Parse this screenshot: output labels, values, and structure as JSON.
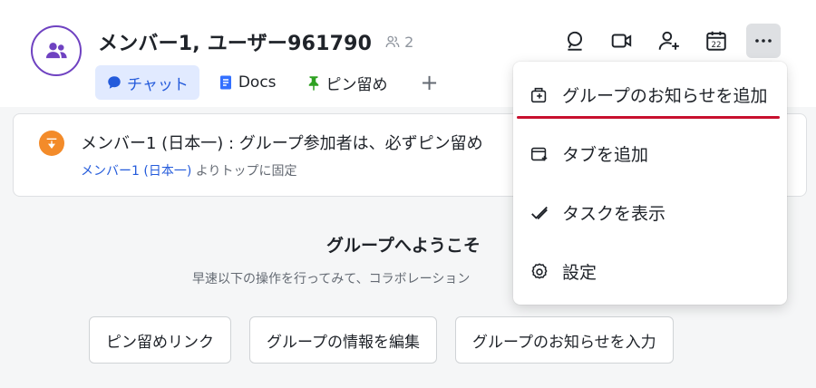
{
  "header": {
    "title": "メンバー1, ユーザー961790",
    "member_count": "2",
    "tabs": [
      {
        "label": "チャット"
      },
      {
        "label": "Docs"
      },
      {
        "label": "ピン留め"
      }
    ],
    "add_tab": "+"
  },
  "toolbar": {
    "icons": [
      "search-icon",
      "video-call-icon",
      "add-member-icon",
      "calendar-icon",
      "more-icon"
    ],
    "calendar_day": "22"
  },
  "pinned": {
    "message": "メンバー1 (日本一) : グループ参加者は、必ずピン留め",
    "by": "メンバー1 (日本一)",
    "suffix": " よりトップに固定"
  },
  "welcome": {
    "title": "グループへようこそ",
    "subtitle": "早速以下の操作を行ってみて、コラボレーション"
  },
  "actions": [
    {
      "label": "ピン留めリンク"
    },
    {
      "label": "グループの情報を編集"
    },
    {
      "label": "グループのお知らせを入力"
    }
  ],
  "menu": {
    "items": [
      {
        "label": "グループのお知らせを追加",
        "icon": "announcement-icon"
      },
      {
        "label": "タブを追加",
        "icon": "add-tab-icon"
      },
      {
        "label": "タスクを表示",
        "icon": "task-check-icon"
      },
      {
        "label": "設定",
        "icon": "gear-icon"
      }
    ],
    "highlight_color": "#c8102e"
  },
  "colors": {
    "accent": "#245bdb",
    "avatar_border": "#6f42c1",
    "pin_orange": "#f38b2a"
  }
}
